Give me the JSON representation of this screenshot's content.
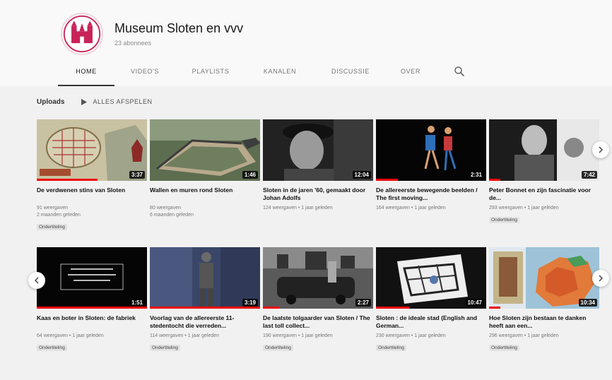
{
  "channel": {
    "name": "Museum Sloten en vvv",
    "subscribers": "23 abonnees"
  },
  "tabs": [
    "HOME",
    "VIDEO'S",
    "PLAYLISTS",
    "KANALEN",
    "DISCUSSIE",
    "OVER"
  ],
  "section": {
    "title": "Uploads",
    "play_all": "ALLES AFSPELEN"
  },
  "videos": [
    {
      "title": "De verdwenen stins van Sloten",
      "views": "91 weergaven",
      "age": "2 maanden geleden",
      "duration": "3:37",
      "badge": "Ondertiteling",
      "progress": 0.55
    },
    {
      "title": "Wallen en muren rond Sloten",
      "views": "80 weergaven",
      "age": "6 maanden geleden",
      "duration": "1:46",
      "badge": "",
      "progress": 0
    },
    {
      "title": "Sloten in de jaren '60, gemaakt door Johan Adolfs",
      "views": "124 weergaven",
      "age": "1 jaar geleden",
      "duration": "12:04",
      "badge": "",
      "progress": 0
    },
    {
      "title": "De allereerste bewegende beelden / The first moving...",
      "views": "164 weergaven",
      "age": "1 jaar geleden",
      "duration": "2:31",
      "badge": "",
      "progress": 0.2
    },
    {
      "title": "Peter Bonnet en zijn fascinatie voor de...",
      "views": "293 weergaven",
      "age": "1 jaar geleden",
      "duration": "7:42",
      "badge": "Ondertiteling",
      "progress": 0.1
    },
    {
      "title": "Kaas en boter in Sloten: de fabriek",
      "views": "64 weergaven",
      "age": "1 jaar geleden",
      "duration": "1:51",
      "badge": "Ondertiteling",
      "progress": 1.0
    },
    {
      "title": "Voorlag van de allereerste 11-stedentocht die verreden...",
      "views": "114 weergaven",
      "age": "1 jaar geleden",
      "duration": "3:19",
      "badge": "Ondertiteling",
      "progress": 1.0
    },
    {
      "title": "De laatste tolgaarder van Sloten / The last toll collect...",
      "views": "190 weergaven",
      "age": "1 jaar geleden",
      "duration": "2:27",
      "badge": "Ondertiteling",
      "progress": 0.15
    },
    {
      "title": "Sloten : de ideale stad (English and German...",
      "views": "230 weergaven",
      "age": "1 jaar geleden",
      "duration": "10:47",
      "badge": "Ondertiteling",
      "progress": 0.3
    },
    {
      "title": "Hoe Sloten zijn bestaan te danken heeft aan een...",
      "views": "296 weergaven",
      "age": "1 jaar geleden",
      "duration": "10:34",
      "badge": "Ondertiteling",
      "progress": 0.1
    }
  ],
  "icons": {
    "search": "search-icon",
    "play": "play-icon",
    "next": "chevron-right-icon",
    "prev": "chevron-left-icon"
  },
  "colors": {
    "brand": "#c8245a",
    "progress": "#e00000"
  }
}
